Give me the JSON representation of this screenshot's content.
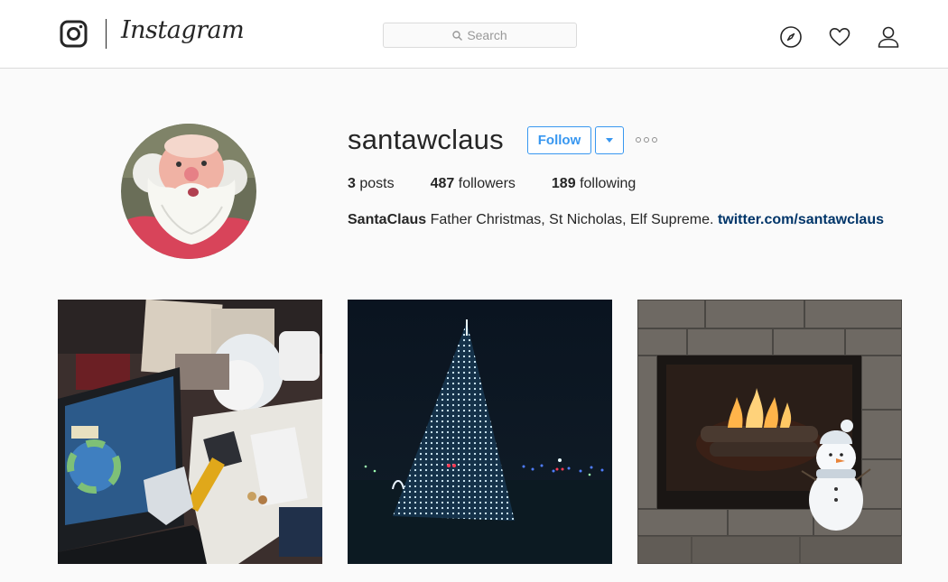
{
  "app": {
    "wordmark": "Instagram"
  },
  "search": {
    "placeholder": "Search"
  },
  "nav": {
    "icons": [
      "instagram-glyph-icon",
      "compass-icon",
      "heart-icon",
      "person-icon",
      "search-icon"
    ]
  },
  "profile": {
    "username": "santawclaus",
    "follow_label": "Follow",
    "stats": {
      "posts_count": "3",
      "posts_label": "posts",
      "followers_count": "487",
      "followers_label": "followers",
      "following_count": "189",
      "following_label": "following"
    },
    "bio": {
      "name": "SantaClaus",
      "text": "Father Christmas, St Nicholas, Elf Supreme.",
      "link": "twitter.com/santawclaus"
    }
  },
  "posts": [
    {
      "subject": "cluttered desk with laptop"
    },
    {
      "subject": "lit christmas tree at night"
    },
    {
      "subject": "fireplace with snowman"
    }
  ],
  "colors": {
    "accent": "#3897f0",
    "link": "#003569",
    "text": "#262626",
    "background": "#fafafa",
    "border": "#dbdbdb"
  }
}
